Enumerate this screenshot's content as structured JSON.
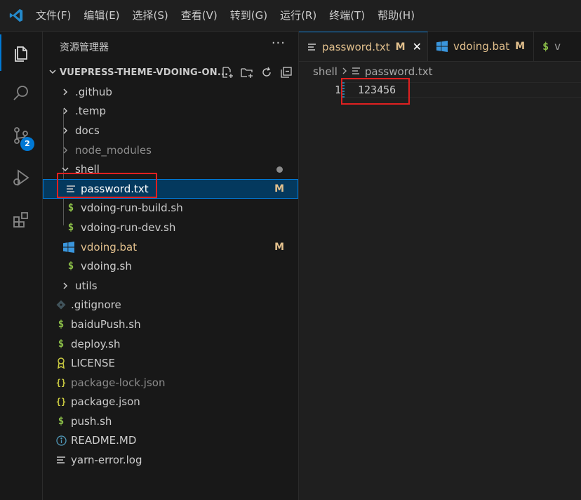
{
  "menu": [
    "文件(F)",
    "编辑(E)",
    "选择(S)",
    "查看(V)",
    "转到(G)",
    "运行(R)",
    "终端(T)",
    "帮助(H)"
  ],
  "activity": {
    "scm_badge": "2"
  },
  "sidebar": {
    "title": "资源管理器",
    "more": "···",
    "project": "VUEPRESS-THEME-VDOING-ON...",
    "items": [
      {
        "label": ".github",
        "kind": "folder",
        "expanded": false
      },
      {
        "label": ".temp",
        "kind": "folder",
        "expanded": false
      },
      {
        "label": "docs",
        "kind": "folder",
        "expanded": false
      },
      {
        "label": "node_modules",
        "kind": "folder",
        "expanded": false
      },
      {
        "label": "shell",
        "kind": "folder",
        "expanded": true
      },
      {
        "label": "password.txt",
        "kind": "file",
        "icon": "text-file-icon",
        "status": "M"
      },
      {
        "label": "vdoing-run-build.sh",
        "kind": "file",
        "icon": "dollar-icon"
      },
      {
        "label": "vdoing-run-dev.sh",
        "kind": "file",
        "icon": "dollar-icon"
      },
      {
        "label": "vdoing.bat",
        "kind": "file",
        "icon": "windows-icon",
        "status": "M"
      },
      {
        "label": "vdoing.sh",
        "kind": "file",
        "icon": "dollar-icon"
      },
      {
        "label": "utils",
        "kind": "folder",
        "expanded": false
      },
      {
        "label": ".gitignore",
        "kind": "file",
        "icon": "git-icon"
      },
      {
        "label": "baiduPush.sh",
        "kind": "file",
        "icon": "dollar-icon"
      },
      {
        "label": "deploy.sh",
        "kind": "file",
        "icon": "dollar-icon"
      },
      {
        "label": "LICENSE",
        "kind": "file",
        "icon": "license-icon"
      },
      {
        "label": "package-lock.json",
        "kind": "file",
        "icon": "json-icon"
      },
      {
        "label": "package.json",
        "kind": "file",
        "icon": "json-icon"
      },
      {
        "label": "push.sh",
        "kind": "file",
        "icon": "dollar-icon"
      },
      {
        "label": "README.MD",
        "kind": "file",
        "icon": "info-icon"
      },
      {
        "label": "yarn-error.log",
        "kind": "file",
        "icon": "text-file-icon"
      }
    ]
  },
  "editor": {
    "tabs": [
      {
        "label": "password.txt",
        "status": "M",
        "active": true,
        "close": "✕"
      },
      {
        "label": "vdoing.bat",
        "status": "M",
        "active": false
      },
      {
        "label": "v",
        "status": "",
        "active": false
      }
    ],
    "breadcrumb": [
      "shell",
      "password.txt"
    ],
    "line_number": "1",
    "line_text": "123456"
  },
  "colors": {
    "accent": "#0078d4",
    "modified": "#e2c08d",
    "highlight": "#e02020"
  }
}
